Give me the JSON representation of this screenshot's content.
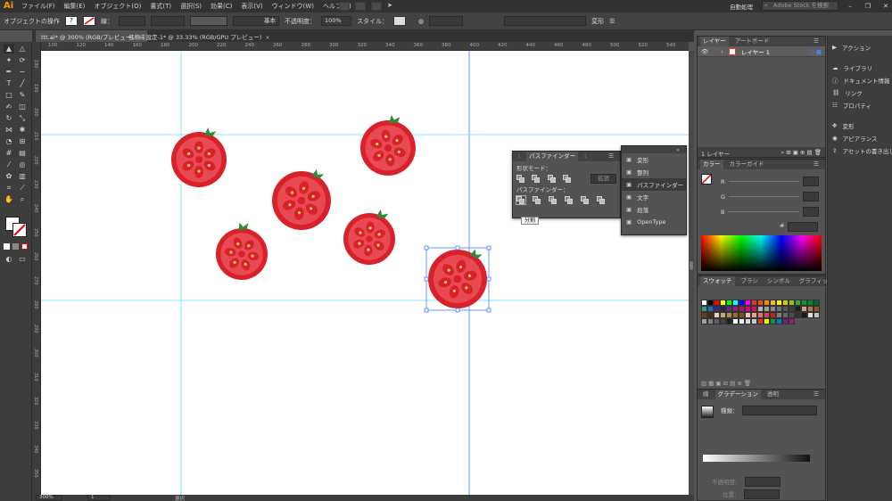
{
  "app": {
    "logo": "Ai",
    "menus": [
      "ファイル(F)",
      "編集(E)",
      "オブジェクト(O)",
      "書式(T)",
      "選択(S)",
      "効果(C)",
      "表示(V)",
      "ウィンドウ(W)",
      "ヘルプ(H)"
    ],
    "workspace_label": "自動処理",
    "stock_search_placeholder": "Adobe Stock を検索"
  },
  "control": {
    "object_label": "オブジェクトの操作",
    "stroke_label": "線：",
    "stroke_style": "基本",
    "opacity_label": "不透明度：",
    "opacity_value": "100%",
    "style_label": "スタイル：",
    "transform_label": "変形"
  },
  "tabs": [
    {
      "label": "ttt.ai* @ 300% (RGB/プレビュー)",
      "active": true
    },
    {
      "label": "名称未設定-1* @ 33.33% (RGB/GPU プレビュー)",
      "active": false
    }
  ],
  "ruler": {
    "top": [
      "100",
      "120",
      "140",
      "160",
      "180",
      "200",
      "220",
      "240",
      "260",
      "280",
      "300",
      "320",
      "340",
      "360",
      "380",
      "400",
      "420",
      "440",
      "460",
      "480",
      "500",
      "520",
      "540"
    ],
    "left": [
      "180",
      "190",
      "200",
      "210",
      "220",
      "230",
      "240",
      "250",
      "260",
      "270",
      "280",
      "290",
      "300",
      "310",
      "320",
      "330",
      "340",
      "350"
    ]
  },
  "status": {
    "zoom": "300%",
    "page": "1",
    "tool": "選択"
  },
  "pathfinder": {
    "tabs": [
      "パスファインダー"
    ],
    "shape_modes_label": "形状モード：",
    "expand_label": "拡張",
    "pathfinders_label": "パスファインダー：",
    "tooltip": "分割"
  },
  "flyout": {
    "items": [
      {
        "label": "変形",
        "icon": "transform-icon",
        "selected": false
      },
      {
        "label": "整列",
        "icon": "align-icon",
        "selected": false
      },
      {
        "label": "パスファインダー",
        "icon": "pathfinder-icon",
        "selected": true
      },
      {
        "label": "文字",
        "icon": "character-icon",
        "selected": false
      },
      {
        "label": "段落",
        "icon": "paragraph-icon",
        "selected": false
      },
      {
        "label": "OpenType",
        "icon": "opentype-icon",
        "selected": false
      }
    ]
  },
  "layers": {
    "tabs": [
      "レイヤー",
      "アートボード"
    ],
    "rows": [
      {
        "name": "レイヤー 1"
      }
    ],
    "footer": "1 レイヤー"
  },
  "color": {
    "tabs": [
      "カラー",
      "カラーガイド"
    ],
    "channels": [
      "R",
      "G",
      "B"
    ],
    "hex_label": "#"
  },
  "swatches": {
    "tabs": [
      "スウォッチ",
      "ブラシ",
      "シンボル",
      "グラフィックスタイル"
    ],
    "colors": [
      "#ffffff",
      "#000000",
      "#ff0000",
      "#ffff00",
      "#00ff00",
      "#00ffff",
      "#0000ff",
      "#ff00ff",
      "#e6332a",
      "#e94e1b",
      "#f39200",
      "#f9b233",
      "#fcea10",
      "#c9d200",
      "#95c11f",
      "#3aaa35",
      "#009640",
      "#008d36",
      "#006633",
      "#2a9d8f",
      "#1d71b8",
      "#2d2e83",
      "#29235c",
      "#662483",
      "#951b81",
      "#a3195b",
      "#e6007e",
      "#d4145a",
      "#b2b2b2",
      "#9d9d9c",
      "#878787",
      "#706f6f",
      "#575756",
      "#3c3c3b",
      "#1d1d1b",
      "#c8a882",
      "#a57c52",
      "#8b5a2b",
      "#6b3e1e",
      "#4d2a14",
      "#e8d5b7",
      "#cfa36d",
      "#b88746",
      "#966b33",
      "#7a5523",
      "#f2c4c4",
      "#ee9b9b",
      "#e66f6f",
      "#d94545",
      "#c02020",
      "#7f7f7f",
      "#666666",
      "#4c4c4c",
      "#333333",
      "#1a1a1a",
      "#e0e0e0",
      "#c0c0c0",
      "#a0a0a0",
      "#808080",
      "#606060",
      "#404040",
      "#202020",
      "#ffffff",
      "#f0f0f0",
      "#d8d8d8",
      "#c8c8c8",
      "#e6332a",
      "#ffed00",
      "#009640",
      "#1d71b8",
      "#662483",
      "#951b81"
    ]
  },
  "gradient": {
    "tabs": [
      "線",
      "グラデーション",
      "透明"
    ],
    "type_label": "種類：",
    "opacity_label": "不透明度：",
    "position_label": "位置："
  },
  "dock": {
    "items": [
      {
        "label": "アクション",
        "icon": "play-icon"
      },
      {
        "label": "ライブラリ",
        "icon": "library-icon"
      },
      {
        "label": "ドキュメント情報",
        "icon": "doc-info-icon"
      },
      {
        "label": "リンク",
        "icon": "link-icon"
      },
      {
        "label": "プロパティ",
        "icon": "properties-icon"
      },
      {
        "label": "変形",
        "icon": "transform-icon"
      },
      {
        "label": "アピアランス",
        "icon": "appearance-icon"
      },
      {
        "label": "アセットの書き出し",
        "icon": "export-icon"
      }
    ]
  },
  "colors": {
    "tomato": "#d8212b",
    "tomato_inner": "#e84a52",
    "seed": "#f7d26a",
    "stem": "#2e8b3a",
    "guide": "#66ddff",
    "selection": "#4a7cff"
  }
}
